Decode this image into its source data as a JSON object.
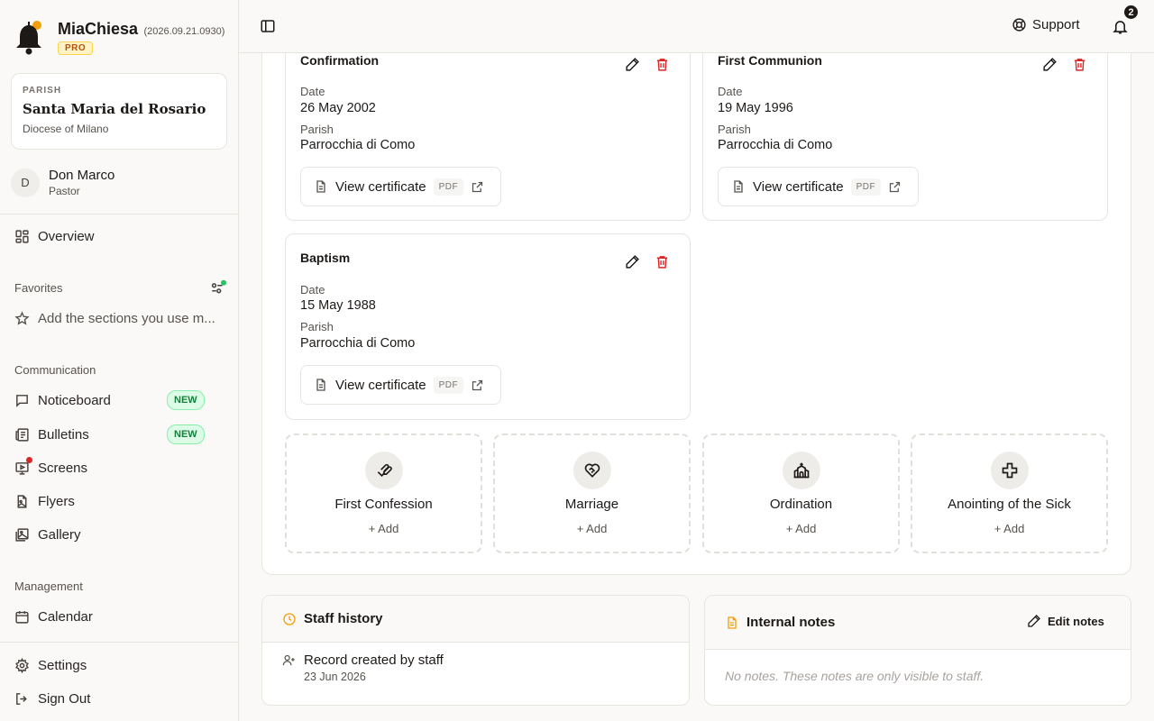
{
  "app": {
    "name": "MiaChiesa",
    "version": "(2026.09.21.0930)",
    "plan": "PRO"
  },
  "parish": {
    "label": "PARISH",
    "name": "Santa Maria del Rosario",
    "diocese": "Diocese of Milano"
  },
  "user": {
    "initial": "D",
    "name": "Don Marco",
    "role": "Pastor"
  },
  "nav": {
    "overview": "Overview",
    "favorites_label": "Favorites",
    "favorites_hint": "Add the sections you use m...",
    "communication_label": "Communication",
    "noticeboard": "Noticeboard",
    "bulletins": "Bulletins",
    "new_badge": "NEW",
    "screens": "Screens",
    "flyers": "Flyers",
    "gallery": "Gallery",
    "management_label": "Management",
    "calendar": "Calendar",
    "settings": "Settings",
    "sign_out": "Sign Out"
  },
  "topbar": {
    "support": "Support",
    "notifications_count": "2"
  },
  "sacraments": [
    {
      "title": "Confirmation",
      "date_label": "Date",
      "date": "26 May 2002",
      "parish_label": "Parish",
      "parish": "Parrocchia di Como",
      "cert_label": "View certificate",
      "cert_tag": "PDF"
    },
    {
      "title": "First Communion",
      "date_label": "Date",
      "date": "19 May 1996",
      "parish_label": "Parish",
      "parish": "Parrocchia di Como",
      "cert_label": "View certificate",
      "cert_tag": "PDF"
    },
    {
      "title": "Baptism",
      "date_label": "Date",
      "date": "15 May 1988",
      "parish_label": "Parish",
      "parish": "Parrocchia di Como",
      "cert_label": "View certificate",
      "cert_tag": "PDF"
    }
  ],
  "add_sacraments": [
    {
      "title": "First Confession",
      "action": "+ Add",
      "icon": "hands-icon"
    },
    {
      "title": "Marriage",
      "action": "+ Add",
      "icon": "heart-handshake-icon"
    },
    {
      "title": "Ordination",
      "action": "+ Add",
      "icon": "church-icon"
    },
    {
      "title": "Anointing of the Sick",
      "action": "+ Add",
      "icon": "cross-icon"
    }
  ],
  "staff_history": {
    "title": "Staff history",
    "entry": "Record created by staff",
    "date": "23 Jun 2026"
  },
  "internal_notes": {
    "title": "Internal notes",
    "edit_label": "Edit notes",
    "empty": "No notes. These notes are only visible to staff."
  },
  "colors": {
    "accent_amber": "#f59e0b",
    "danger": "#dc2626",
    "success": "#22c55e",
    "new_badge": "#15803d"
  }
}
